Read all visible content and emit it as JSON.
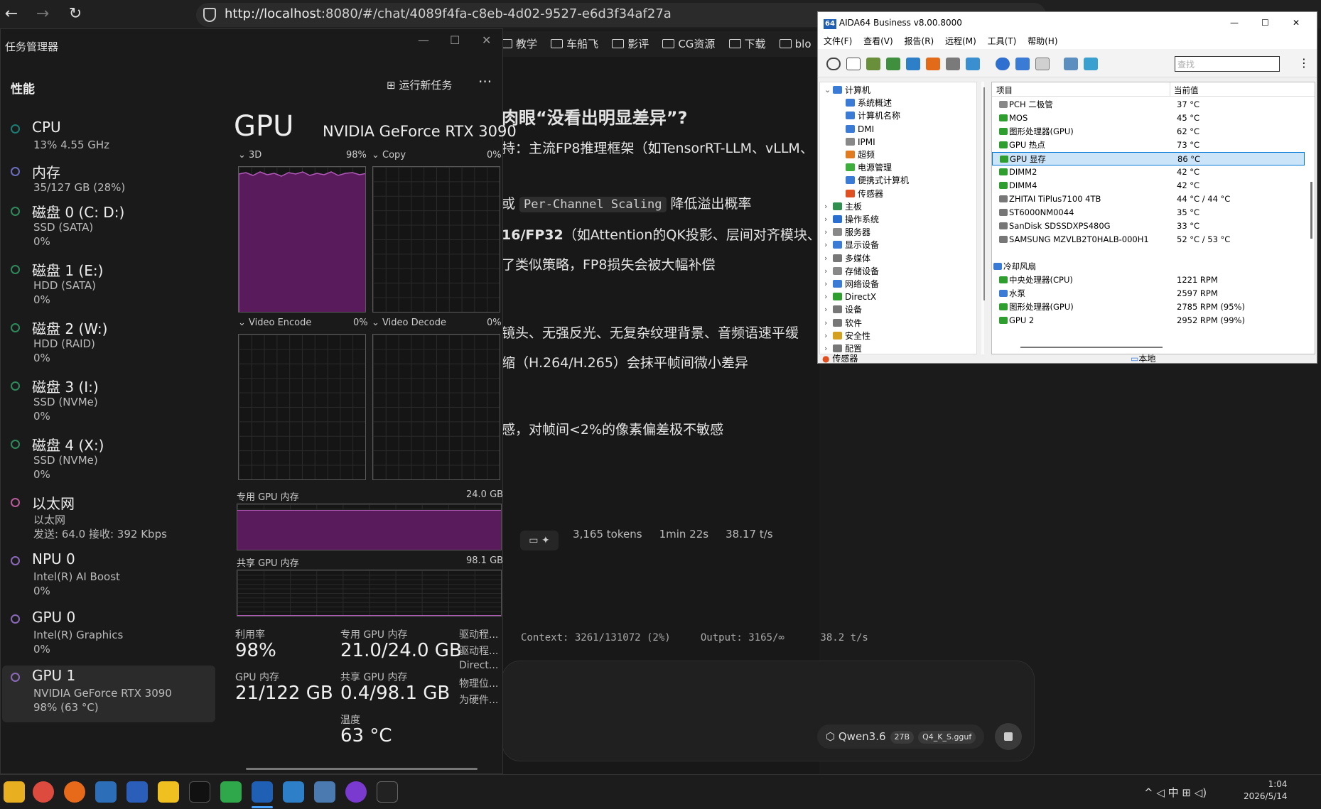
{
  "browser": {
    "url": "http://localhost:8080/#/chat/4089f4fa-c8eb-4d02-9527-e6d3f34af27a",
    "url_host": "http://localhost",
    "url_rest": ":8080/#/chat/4089f4fa-c8eb-4d02-9527-e6d3f34af27a",
    "bookmarks": [
      "教学",
      "车船飞",
      "影评",
      "CG资源",
      "下载",
      "blo"
    ]
  },
  "chat": {
    "lines": [
      {
        "text": "肉眼“没看出明显差异”?",
        "bold": true
      },
      {
        "text": "持：主流FP8推理框架（如TensorRT-LLM、vLLM、"
      },
      {
        "pre": "或 ",
        "code": "Per-Channel Scaling",
        "post": " 降低溢出概率"
      },
      {
        "bold_text": "16/FP32",
        "post": "（如Attention的QK投影、层间对齐模块、"
      },
      {
        "text": "了类似策略，FP8损失会被大幅补偿"
      },
      {
        "text": "镜头、无强反光、无复杂纹理背景、音频语速平缓"
      },
      {
        "text": "缩（H.264/H.265）会抹平帧间微小差异"
      },
      {
        "text": "感，对帧间<2%的像素偏差极不敏感"
      }
    ],
    "meta": {
      "tokens": "3,165 tokens",
      "time": "1min 22s",
      "speed": "38.17 t/s"
    },
    "status": "Context: 3261/131072 (2%)     Output: 3165/∞      38.2 t/s",
    "model": "Qwen3.6",
    "model_size": "27B",
    "model_quant": "Q4_K_S.gguf"
  },
  "taskmgr": {
    "title": "任务管理器",
    "section": "性能",
    "run_task": "运行新任务",
    "more": "···",
    "items": [
      {
        "name": "CPU",
        "sub": "13% 4.55 GHz",
        "val": "",
        "color": "#1d7d74"
      },
      {
        "name": "内存",
        "sub": "35/127 GB (28%)",
        "val": "",
        "color": "#6e6ec0"
      },
      {
        "name": "磁盘 0 (C: D:)",
        "sub": "SSD (SATA)",
        "val": "0%",
        "color": "#2e8a5c"
      },
      {
        "name": "磁盘 1 (E:)",
        "sub": "HDD (SATA)",
        "val": "0%",
        "color": "#2e8a5c"
      },
      {
        "name": "磁盘 2 (W:)",
        "sub": "HDD (RAID)",
        "val": "0%",
        "color": "#2e8a5c"
      },
      {
        "name": "磁盘 3 (I:)",
        "sub": "SSD (NVMe)",
        "val": "0%",
        "color": "#2e8a5c"
      },
      {
        "name": "磁盘 4 (X:)",
        "sub": "SSD (NVMe)",
        "val": "0%",
        "color": "#2e8a5c"
      },
      {
        "name": "以太网",
        "sub": "以太网",
        "val": "发送: 64.0 接收: 392 Kbps",
        "color": "#b85c9a"
      },
      {
        "name": "NPU 0",
        "sub": "Intel(R) AI Boost",
        "val": "0%",
        "color": "#8a6ab8"
      },
      {
        "name": "GPU 0",
        "sub": "Intel(R) Graphics",
        "val": "0%",
        "color": "#8a6ab8"
      },
      {
        "name": "GPU 1",
        "sub": "NVIDIA GeForce RTX 3090",
        "val": "98% (63 °C)",
        "color": "#8a6ab8"
      }
    ],
    "gpu_title": "GPU",
    "gpu_model": "NVIDIA GeForce RTX 3090",
    "graphs": [
      {
        "label": "3D",
        "pct": "98%",
        "fill": 0.98
      },
      {
        "label": "Copy",
        "pct": "0%",
        "fill": 0
      },
      {
        "label": "Video Encode",
        "pct": "0%",
        "fill": 0
      },
      {
        "label": "Video Decode",
        "pct": "0%",
        "fill": 0
      }
    ],
    "dedicated": {
      "label": "专用 GPU 内存",
      "max": "24.0 GB",
      "fill": 0.875
    },
    "shared": {
      "label": "共享 GPU 内存",
      "max": "98.1 GB",
      "fill": 0.004
    },
    "stats": {
      "util_label": "利用率",
      "util": "98%",
      "ded_label": "专用 GPU 内存",
      "ded": "21.0/24.0 GB",
      "gpumem_label": "GPU 内存",
      "gpumem": "21/122 GB",
      "shared_label": "共享 GPU 内存",
      "shared": "0.4/98.1 GB",
      "temp_label": "温度",
      "temp": "63 °C",
      "drivers": [
        "驱动程...",
        "驱动程...",
        "Direct...",
        "物理位...",
        "为硬件..."
      ]
    }
  },
  "aida": {
    "title": "AIDA64 Business v8.00.8000",
    "badge": "64",
    "menu": [
      "文件(F)",
      "查看(V)",
      "报告(R)",
      "远程(M)",
      "工具(T)",
      "帮助(H)"
    ],
    "search_placeholder": "查找",
    "tree": [
      {
        "label": "计算机",
        "indent": 0,
        "arrow": "⌄",
        "color": "#3a7bd5"
      },
      {
        "label": "系统概述",
        "indent": 1,
        "color": "#3a7bd5"
      },
      {
        "label": "计算机名称",
        "indent": 1,
        "color": "#3a7bd5"
      },
      {
        "label": "DMI",
        "indent": 1,
        "color": "#3a7bd5"
      },
      {
        "label": "IPMI",
        "indent": 1,
        "color": "#888"
      },
      {
        "label": "超频",
        "indent": 1,
        "color": "#e07b20"
      },
      {
        "label": "电源管理",
        "indent": 1,
        "color": "#3cae3c"
      },
      {
        "label": "便携式计算机",
        "indent": 1,
        "color": "#3a7bd5"
      },
      {
        "label": "传感器",
        "indent": 1,
        "color": "#e05020"
      },
      {
        "label": "主板",
        "indent": 0,
        "arrow": "›",
        "color": "#2f8f4f"
      },
      {
        "label": "操作系统",
        "indent": 0,
        "arrow": "›",
        "color": "#2a6fd0"
      },
      {
        "label": "服务器",
        "indent": 0,
        "arrow": "›",
        "color": "#888"
      },
      {
        "label": "显示设备",
        "indent": 0,
        "arrow": "›",
        "color": "#3a7bd5"
      },
      {
        "label": "多媒体",
        "indent": 0,
        "arrow": "›",
        "color": "#777"
      },
      {
        "label": "存储设备",
        "indent": 0,
        "arrow": "›",
        "color": "#888"
      },
      {
        "label": "网络设备",
        "indent": 0,
        "arrow": "›",
        "color": "#3a7bd5"
      },
      {
        "label": "DirectX",
        "indent": 0,
        "arrow": "›",
        "color": "#2e9e2e"
      },
      {
        "label": "设备",
        "indent": 0,
        "arrow": "›",
        "color": "#777"
      },
      {
        "label": "软件",
        "indent": 0,
        "arrow": "›",
        "color": "#777"
      },
      {
        "label": "安全性",
        "indent": 0,
        "arrow": "›",
        "color": "#d4a020"
      },
      {
        "label": "配置",
        "indent": 0,
        "arrow": "›",
        "color": "#777"
      }
    ],
    "col_item": "项目",
    "col_value": "当前值",
    "rows": [
      {
        "name": "PCH 二极管",
        "value": "37 °C",
        "color": "#888"
      },
      {
        "name": "MOS",
        "value": "45 °C",
        "color": "#2e9e2e"
      },
      {
        "name": "图形处理器(GPU)",
        "value": "62 °C",
        "color": "#2e9e2e"
      },
      {
        "name": "GPU 热点",
        "value": "73 °C",
        "color": "#2e9e2e"
      },
      {
        "name": "GPU 显存",
        "value": "86 °C",
        "color": "#2e9e2e",
        "sel": true
      },
      {
        "name": "DIMM2",
        "value": "42 °C",
        "color": "#2e9e2e"
      },
      {
        "name": "DIMM4",
        "value": "42 °C",
        "color": "#2e9e2e"
      },
      {
        "name": "ZHITAI TiPlus7100 4TB",
        "value": "44 °C / 44 °C",
        "color": "#777"
      },
      {
        "name": "ST6000NM0044",
        "value": "35 °C",
        "color": "#777"
      },
      {
        "name": "SanDisk SDSSDXPS480G",
        "value": "33 °C",
        "color": "#777"
      },
      {
        "name": "SAMSUNG MZVLB2T0HALB-000H1",
        "value": "52 °C / 53 °C",
        "color": "#777"
      },
      {
        "name": "",
        "value": "",
        "color": "transparent"
      },
      {
        "name": "冷却风扇",
        "value": "",
        "color": "#3a7bd5",
        "header": true
      },
      {
        "name": "中央处理器(CPU)",
        "value": "1221 RPM",
        "color": "#2e9e2e"
      },
      {
        "name": "水泵",
        "value": "2597 RPM",
        "color": "#3a7bd5"
      },
      {
        "name": "图形处理器(GPU)",
        "value": "2785 RPM  (95%)",
        "color": "#2e9e2e"
      },
      {
        "name": "GPU 2",
        "value": "2952 RPM  (99%)",
        "color": "#2e9e2e"
      }
    ],
    "status_left": "传感器",
    "status_right": "本地"
  },
  "taskbar": {
    "tray": "^  ◁  中  ⊞  ◁)",
    "time": "1:04",
    "date": "2026/5/14"
  }
}
